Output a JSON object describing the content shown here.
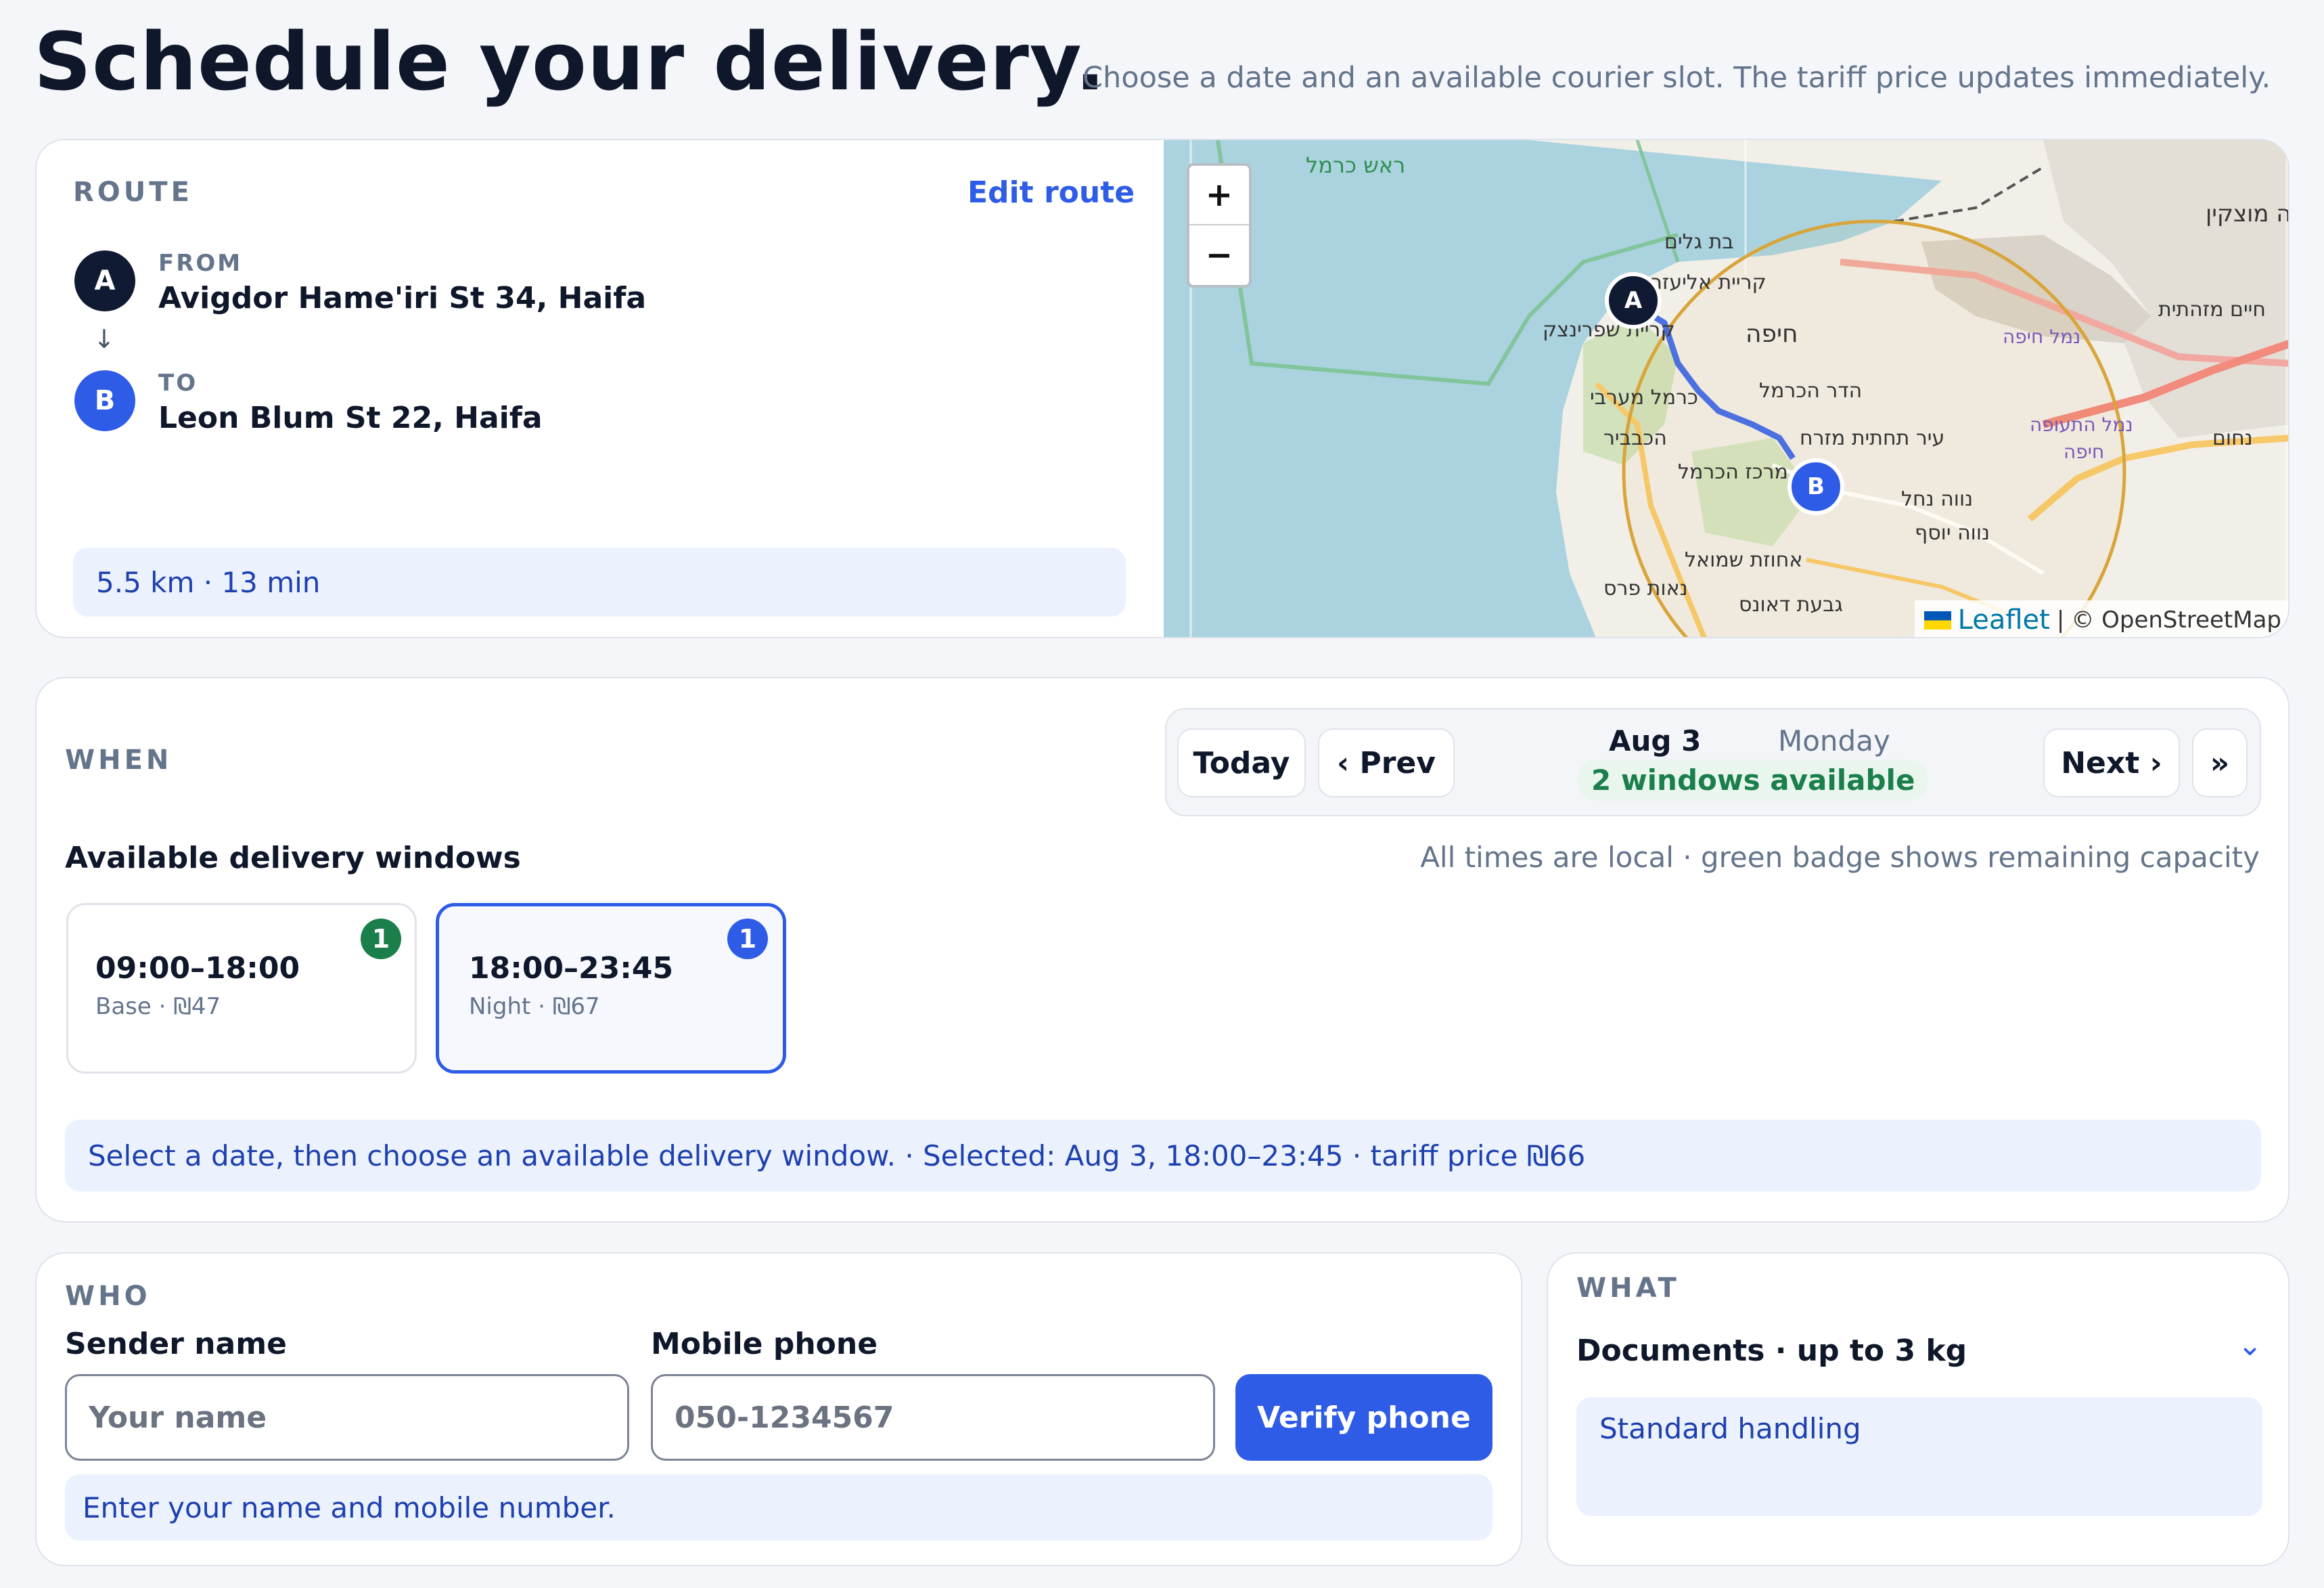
{
  "header": {
    "title": "Schedule your delivery.",
    "subtitle": "Choose a date and an available courier slot. The tariff price updates immediately."
  },
  "route": {
    "section_label": "ROUTE",
    "edit_label": "Edit route",
    "from_label": "FROM",
    "from_address": "Avigdor Hame'iri St 34, Haifa",
    "from_pin": "A",
    "arrow": "↓",
    "to_label": "TO",
    "to_address": "Leon Blum St 22, Haifa",
    "to_pin": "B",
    "summary": "5.5 km · 13 min"
  },
  "map": {
    "zoom_in": "+",
    "zoom_out": "−",
    "attribution_leaflet": "Leaflet",
    "attribution_separator": "|",
    "attribution_osm": "© OpenStreetMap",
    "pin_a": "A",
    "pin_b": "B",
    "place_labels": [
      "ראש כרמל",
      "בת גלים",
      "קריית אליעזר",
      "קריית שפרינצק",
      "חיפה",
      "כרמל מערבי",
      "הדר הכרמל",
      "הכבביר",
      "עיר תחתית מזרח",
      "מרכז הכרמל",
      "נווה נחל",
      "נווה יוסף",
      "אחוזת שמואל",
      "נאות פרס",
      "גבעת דאונס",
      "נמל חיפה",
      "נמל התעופה חיפה",
      "נוה מוצקין",
      "חיים מזהתית",
      "נחום"
    ],
    "colors": {
      "sea": "#aad3df",
      "land": "#f2efe9",
      "route": "#3b63e0",
      "radius": "#d9a53a"
    }
  },
  "when": {
    "section_label": "WHEN",
    "today_label": "Today",
    "prev_label": "‹ Prev",
    "date_label": "Aug 3",
    "weekday_label": "Monday",
    "availability_label": "2 windows available",
    "next_label": "Next ›",
    "last_label": "»",
    "windows_heading": "Available delivery windows",
    "windows_note": "All times are local · green badge shows remaining capacity",
    "windows": [
      {
        "time": "09:00–18:00",
        "tier": "Base · ₪47",
        "capacity": "1",
        "selected": false,
        "badge_color": "#1a7f4b"
      },
      {
        "time": "18:00–23:45",
        "tier": "Night · ₪67",
        "capacity": "1",
        "selected": true,
        "badge_color": "#2e5ce6"
      }
    ],
    "status_message": "Select a date, then choose an available delivery window. · Selected: Aug 3, 18:00–23:45 · tariff price ₪66"
  },
  "who": {
    "section_label": "WHO",
    "name_label": "Sender name",
    "name_placeholder": "Your name",
    "name_value": "",
    "phone_label": "Mobile phone",
    "phone_placeholder": "050-1234567",
    "phone_value": "",
    "verify_label": "Verify phone",
    "hint": "Enter your name and mobile number."
  },
  "what": {
    "section_label": "WHAT",
    "package_selected": "Documents · up to 3 kg",
    "dropdown_icon": "⌄",
    "handling_value": "Standard handling"
  },
  "colors": {
    "accent": "#2e5ce6",
    "navy": "#111a33",
    "success": "#1a7f4b",
    "info_bg": "#ebf2fd",
    "info_text": "#1e40af"
  }
}
